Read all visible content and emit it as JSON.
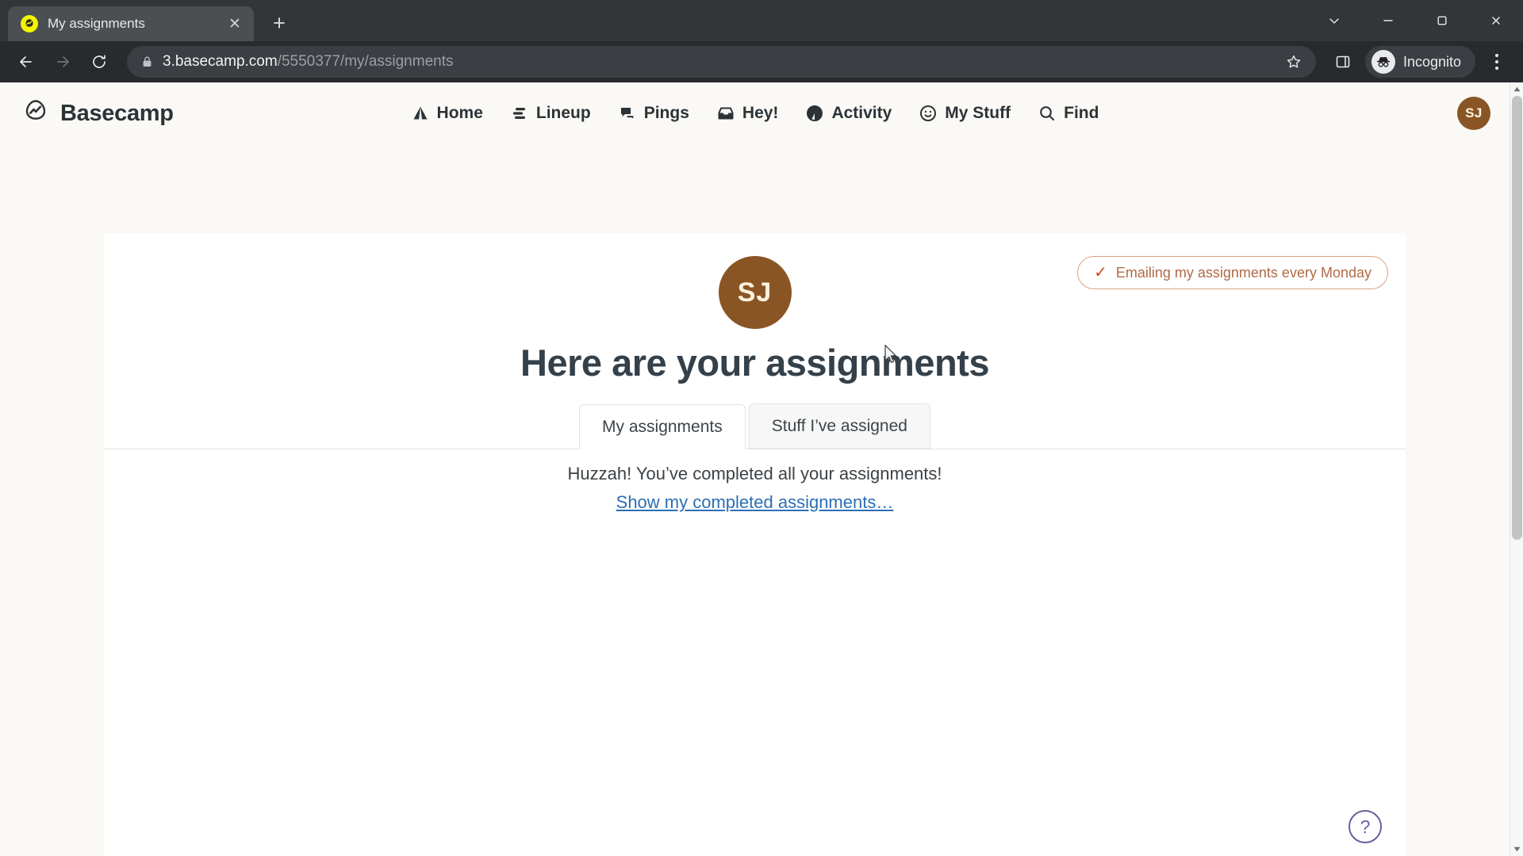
{
  "browser": {
    "tab": {
      "title": "My assignments",
      "favicon": "basecamp-favicon",
      "close_label": "✕"
    },
    "newtab_label": "+",
    "window_controls": {
      "minimize": "minimize-icon",
      "maximize": "maximize-icon",
      "restore": "restore-icon",
      "close": "close-icon"
    },
    "nav": {
      "back": "back-arrow-icon",
      "forward": "forward-arrow-icon",
      "reload": "reload-icon"
    },
    "omnibox": {
      "lock": "lock-icon",
      "url_domain": "3.basecamp.com",
      "url_path": "/5550377/my/assignments",
      "bookmark": "star-icon",
      "side_panel": "side-panel-icon"
    },
    "incognito": {
      "label": "Incognito",
      "icon": "incognito-icon"
    },
    "menu": "kebab-menu-icon"
  },
  "app": {
    "brand": {
      "name": "Basecamp",
      "logo": "basecamp-logo-icon"
    },
    "nav_items": [
      {
        "label": "Home",
        "icon": "tent-icon"
      },
      {
        "label": "Lineup",
        "icon": "lineup-bars-icon"
      },
      {
        "label": "Pings",
        "icon": "speech-bubbles-icon"
      },
      {
        "label": "Hey!",
        "icon": "inbox-tray-icon"
      },
      {
        "label": "Activity",
        "icon": "pie-chart-icon"
      },
      {
        "label": "My Stuff",
        "icon": "smiley-face-icon"
      },
      {
        "label": "Find",
        "icon": "search-icon"
      }
    ],
    "account_avatar": {
      "initials": "SJ",
      "color": "#8a5524"
    }
  },
  "main": {
    "email_pill": {
      "check": "✓",
      "label": "Emailing my assignments every Monday",
      "border_color": "#d9a282",
      "text_color": "#b06a46"
    },
    "avatar": {
      "initials": "SJ",
      "color": "#8a5524"
    },
    "headline": "Here are your assignments",
    "tabs": [
      {
        "label": "My assignments",
        "active": true
      },
      {
        "label": "Stuff I’ve assigned",
        "active": false
      }
    ],
    "empty_state": {
      "message": "Huzzah! You’ve completed all your assignments!",
      "link": "Show my completed assignments…",
      "link_color": "#2c6eb5"
    },
    "help_button": {
      "label": "?",
      "color": "#6b5e9e"
    }
  }
}
